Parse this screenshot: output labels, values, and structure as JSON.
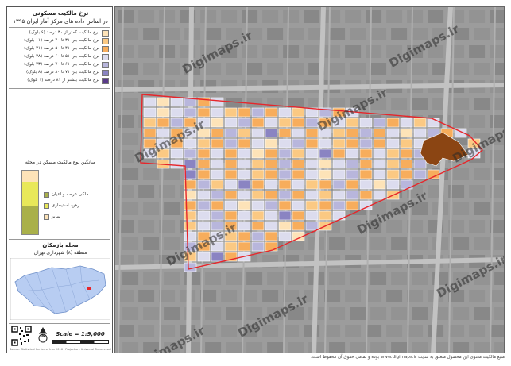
{
  "legend": {
    "title_line1": "نرخ مالکیت مسکونی",
    "title_line2": "در اساس داده های مرکز آمار ایران ۱۳۹۵",
    "items": [
      {
        "label": "نرخ مالکیت کمتر از ۳۰ درصد (۶ بلوک)",
        "color": "#fde3b8"
      },
      {
        "label": "نرخ مالکیت بین ۳۱ تا ۴۰ درصد (۱۱ بلوک)",
        "color": "#fbc983"
      },
      {
        "label": "نرخ مالکیت بین ۴۱ تا ۵۰ درصد (۳۱ بلوک)",
        "color": "#f7ad5c"
      },
      {
        "label": "نرخ مالکیت بین ۵۱ تا ۶۰ درصد (۳۸ بلوک)",
        "color": "#dcdcee"
      },
      {
        "label": "نرخ مالکیت بین ۶۱ تا ۷۰ درصد (۲۳ بلوک)",
        "color": "#b8b6dc"
      },
      {
        "label": "نرخ مالکیت بین ۷۱ تا ۸۰ درصد (۸ بلوک)",
        "color": "#8a84c2"
      },
      {
        "label": "نرخ مالکیت بیشتر از ۸۱ درصد (۱ بلوک)",
        "color": "#5a3a8a"
      }
    ],
    "chart_title": "میانگین نوع مالکیت مسکن در محله",
    "chart_items": [
      {
        "label": "ملکی عرصه و اعیان",
        "color": "#a9b04a"
      },
      {
        "label": "رهن، استیجاری",
        "color": "#e8e85a"
      },
      {
        "label": "سایر",
        "color": "#fde3b8"
      }
    ],
    "neighborhood_title": "محله بازمکان",
    "district_title": "منطقه (۸) شهرداری تهران",
    "scale": "Scale = 1:9,000",
    "north": "N",
    "credit_small": "Source: Statistical Center of Iran 2016 · Projection: Universal Transverse Mercator"
  },
  "map": {
    "watermark": "Digimaps.ir",
    "boundary_color": "#e6262b",
    "road_color": "#bfbfbf"
  },
  "footer": "منبع مالکیت معنوی این محصول متعلق به سایت www.digimaps.ir بوده و تمامی حقوق آن محفوظ است."
}
